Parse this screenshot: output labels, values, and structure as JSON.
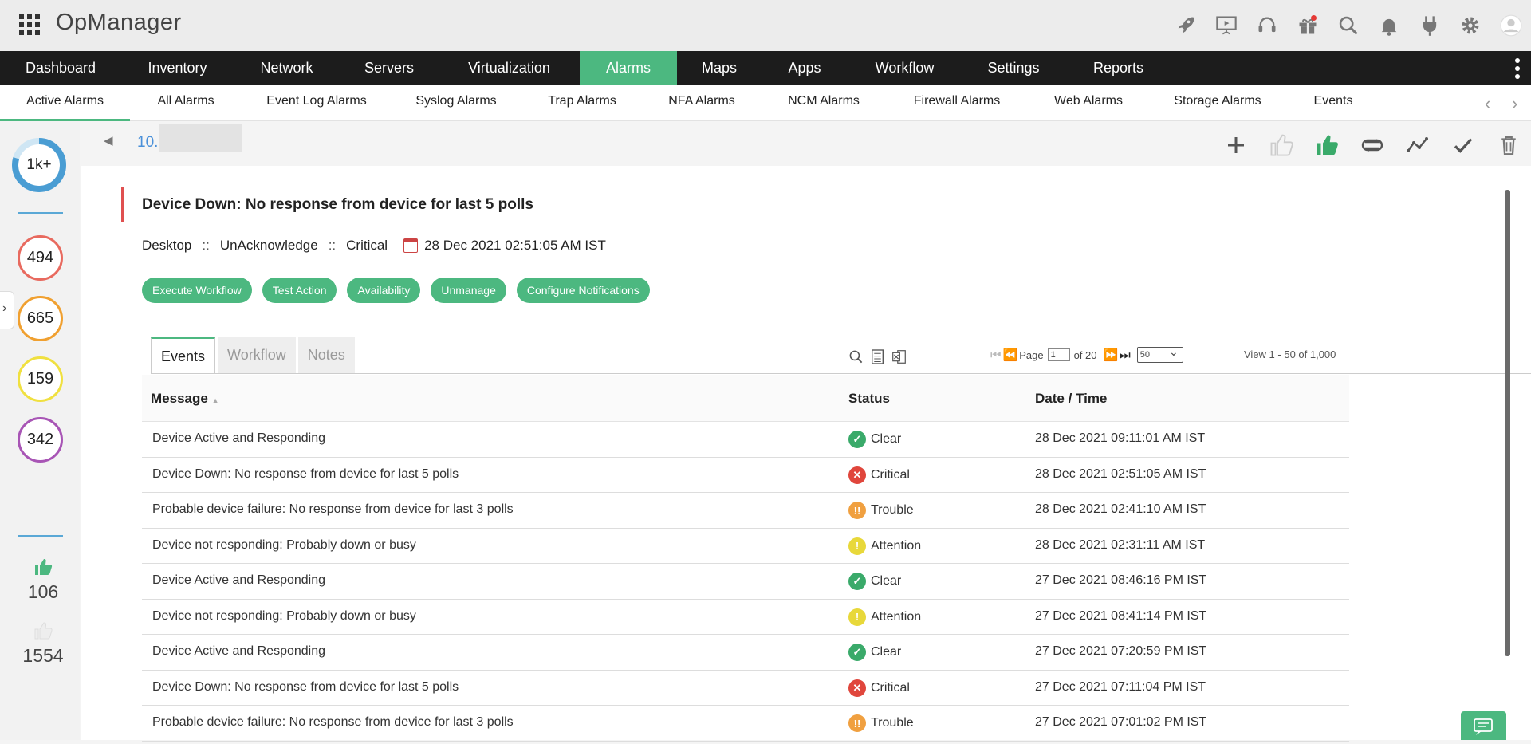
{
  "app": {
    "name": "OpManager"
  },
  "header_icons": [
    "rocket-icon",
    "presentation-icon",
    "headset-icon",
    "gift-icon",
    "search-icon",
    "bell-icon",
    "plug-icon",
    "gear-icon",
    "user-avatar-icon"
  ],
  "nav": {
    "items": [
      {
        "label": "Dashboard",
        "active": false
      },
      {
        "label": "Inventory",
        "active": false
      },
      {
        "label": "Network",
        "active": false
      },
      {
        "label": "Servers",
        "active": false
      },
      {
        "label": "Virtualization",
        "active": false
      },
      {
        "label": "Alarms",
        "active": true
      },
      {
        "label": "Maps",
        "active": false
      },
      {
        "label": "Apps",
        "active": false
      },
      {
        "label": "Workflow",
        "active": false
      },
      {
        "label": "Settings",
        "active": false
      },
      {
        "label": "Reports",
        "active": false
      }
    ]
  },
  "subnav": {
    "items": [
      {
        "label": "Active Alarms",
        "active": true
      },
      {
        "label": "All Alarms"
      },
      {
        "label": "Event Log Alarms"
      },
      {
        "label": "Syslog Alarms"
      },
      {
        "label": "Trap Alarms"
      },
      {
        "label": "NFA Alarms"
      },
      {
        "label": "NCM Alarms"
      },
      {
        "label": "Firewall Alarms"
      },
      {
        "label": "Web Alarms"
      },
      {
        "label": "Storage Alarms"
      },
      {
        "label": "Events"
      }
    ]
  },
  "left_panel": {
    "total": "1k+",
    "severity_counts": [
      {
        "value": "494",
        "color": "#e86a5f"
      },
      {
        "value": "665",
        "color": "#f0a030"
      },
      {
        "value": "159",
        "color": "#f0e040"
      },
      {
        "value": "342",
        "color": "#a855b5"
      }
    ],
    "acknowledged": "106",
    "unacknowledged": "1554"
  },
  "device": {
    "ip_prefix": "10."
  },
  "alarm": {
    "title": "Device Down: No response from device for last 5 polls",
    "category": "Desktop",
    "ack_state": "UnAcknowledge",
    "severity": "Critical",
    "separator": "::",
    "datetime": "28 Dec 2021 02:51:05 AM IST",
    "buttons": [
      "Execute Workflow",
      "Test Action",
      "Availability",
      "Unmanage",
      "Configure Notifications"
    ]
  },
  "tabs": [
    {
      "label": "Events",
      "active": true
    },
    {
      "label": "Workflow",
      "active": false
    },
    {
      "label": "Notes",
      "active": false
    }
  ],
  "pager": {
    "page_label": "Page",
    "page": "1",
    "of_label": "of 20",
    "per_page": "50",
    "view_info": "View 1 - 50 of 1,000"
  },
  "table": {
    "columns": [
      "Message",
      "Status",
      "Date / Time"
    ],
    "rows": [
      {
        "message": "Device Active and Responding",
        "status": "Clear",
        "datetime": "28 Dec 2021 09:11:01 AM IST"
      },
      {
        "message": "Device Down: No response from device for last 5 polls",
        "status": "Critical",
        "datetime": "28 Dec 2021 02:51:05 AM IST"
      },
      {
        "message": "Probable device failure: No response from device for last 3 polls",
        "status": "Trouble",
        "datetime": "28 Dec 2021 02:41:10 AM IST"
      },
      {
        "message": "Device not responding: Probably down or busy",
        "status": "Attention",
        "datetime": "28 Dec 2021 02:31:11 AM IST"
      },
      {
        "message": "Device Active and Responding",
        "status": "Clear",
        "datetime": "27 Dec 2021 08:46:16 PM IST"
      },
      {
        "message": "Device not responding: Probably down or busy",
        "status": "Attention",
        "datetime": "27 Dec 2021 08:41:14 PM IST"
      },
      {
        "message": "Device Active and Responding",
        "status": "Clear",
        "datetime": "27 Dec 2021 07:20:59 PM IST"
      },
      {
        "message": "Device Down: No response from device for last 5 polls",
        "status": "Critical",
        "datetime": "27 Dec 2021 07:11:04 PM IST"
      },
      {
        "message": "Probable device failure: No response from device for last 3 polls",
        "status": "Trouble",
        "datetime": "27 Dec 2021 07:01:02 PM IST"
      }
    ]
  },
  "status_colors": {
    "Clear": "#3aaa6a",
    "Critical": "#e0463c",
    "Trouble": "#f0a040",
    "Attention": "#e8d83a"
  },
  "accent": "#4cb880"
}
